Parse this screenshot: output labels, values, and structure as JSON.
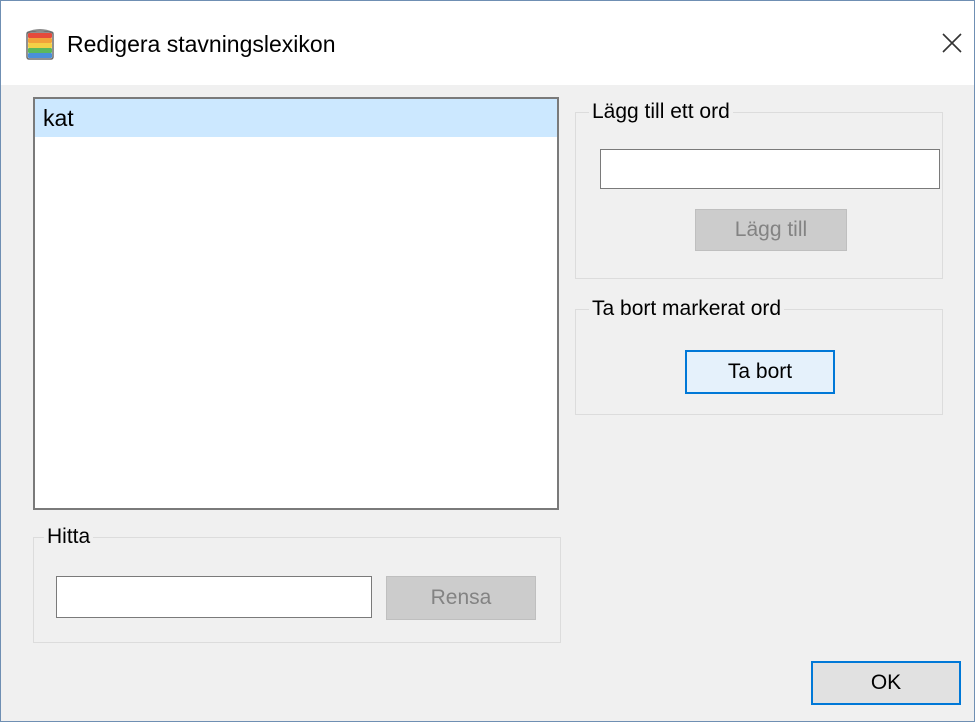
{
  "window": {
    "title": "Redigera stavningslexikon",
    "icon": "book-icon",
    "close_icon": "close-icon"
  },
  "word_list": {
    "items": [
      "kat"
    ],
    "selected_index": 0
  },
  "find_group": {
    "label": "Hitta",
    "input_value": "",
    "clear_button": "Rensa"
  },
  "add_group": {
    "label": "Lägg till ett ord",
    "input_value": "",
    "add_button": "Lägg till"
  },
  "remove_group": {
    "label": "Ta bort markerat ord",
    "remove_button": "Ta bort"
  },
  "ok_button": "OK",
  "colors": {
    "selection": "#cce8ff",
    "accent": "#0078d7",
    "dialog_bg": "#f0f0f0"
  }
}
